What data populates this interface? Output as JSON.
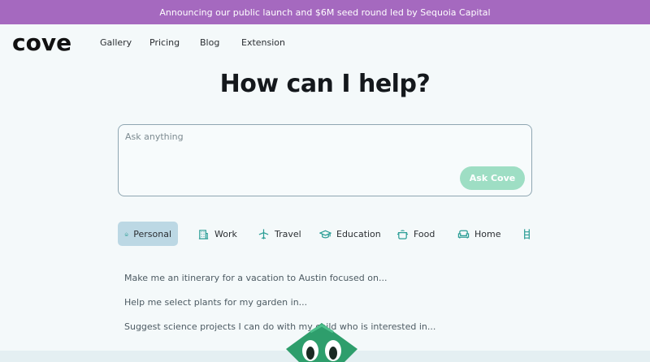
{
  "banner": {
    "text": "Announcing our public launch and $6M seed round led by Sequoia Capital"
  },
  "nav": {
    "logo": "cove",
    "links": [
      "Gallery",
      "Pricing",
      "Blog",
      "Extension"
    ]
  },
  "hero": {
    "title": "How can I help?"
  },
  "ask": {
    "placeholder": "Ask anything",
    "value": "",
    "button_label": "Ask Cove"
  },
  "categories": [
    {
      "label": "Personal",
      "icon": "house-icon",
      "active": true
    },
    {
      "label": "Work",
      "icon": "building-icon",
      "active": false
    },
    {
      "label": "Travel",
      "icon": "airplane-icon",
      "active": false
    },
    {
      "label": "Education",
      "icon": "graduation-cap-icon",
      "active": false
    },
    {
      "label": "Food",
      "icon": "pot-icon",
      "active": false
    },
    {
      "label": "Home",
      "icon": "sofa-icon",
      "active": false
    },
    {
      "label": "",
      "icon": "ladder-icon",
      "active": false
    }
  ],
  "suggestions": [
    "Make me an itinerary for a vacation to Austin focused on...",
    "Help me select plants for my garden in...",
    "Suggest science projects I can do with my child who is interested in..."
  ],
  "colors": {
    "banner": "#a569bf",
    "accent": "#2a9d95",
    "button": "#9edec4",
    "active_tab": "#bcd8e4",
    "mascot": "#2e9e6c"
  }
}
